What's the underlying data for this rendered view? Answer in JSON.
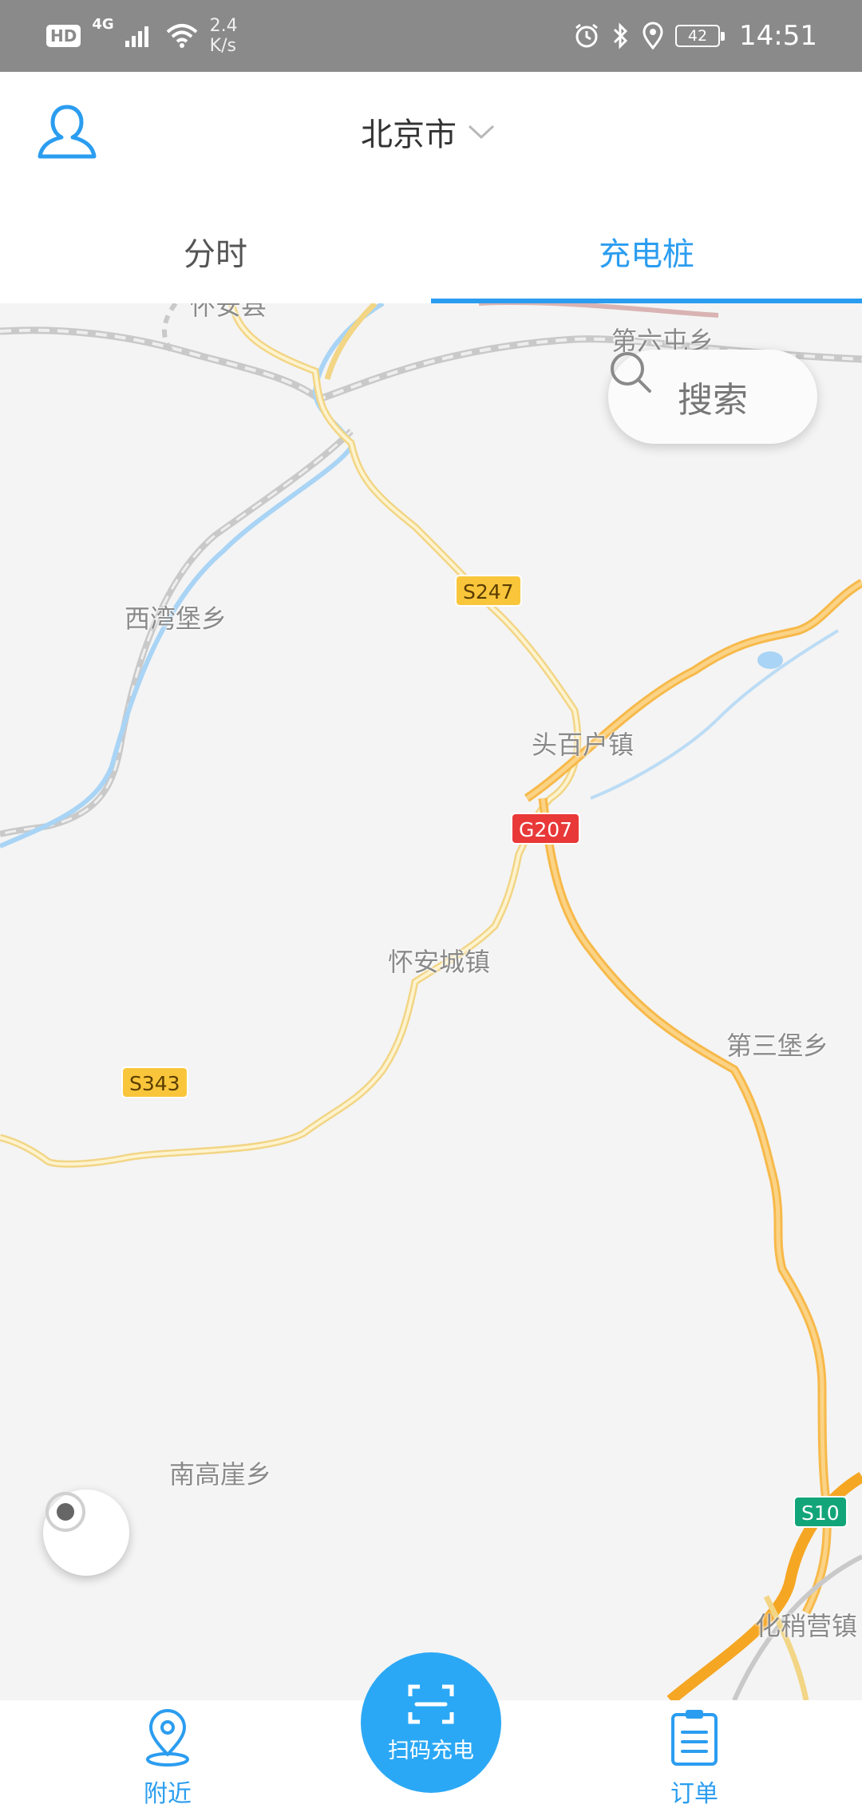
{
  "status_bar": {
    "hd": "HD",
    "network": "4G",
    "speed_value": "2.4",
    "speed_unit": "K/s",
    "battery": "42",
    "time": "14:51"
  },
  "header": {
    "city": "北京市"
  },
  "tabs": [
    {
      "label": "分时",
      "active": false
    },
    {
      "label": "充电桩",
      "active": true
    }
  ],
  "map": {
    "search_label": "搜索",
    "places": [
      "怀安县",
      "第六屯乡",
      "西湾堡乡",
      "头百户镇",
      "怀安城镇",
      "第三堡乡",
      "南高崖乡",
      "化稍营镇"
    ],
    "roads": [
      "S247",
      "G207",
      "S343",
      "S10"
    ]
  },
  "bottom_nav": {
    "nearby_label": "附近",
    "scan_label": "扫码充电",
    "orders_label": "订单"
  },
  "colors": {
    "accent": "#2b9df0",
    "status_bar": "#8a8a8a",
    "map_bg": "#f4f4f4",
    "road_major": "#f7b94a",
    "road_minor": "#f6df9a",
    "river": "#a9d4f5"
  },
  "icons": {
    "profile": "user-icon",
    "city_dropdown": "chevron-down-icon",
    "search": "search-icon",
    "locate": "locate-icon",
    "nearby": "location-pin-icon",
    "scan": "scan-icon",
    "orders": "clipboard-icon"
  }
}
